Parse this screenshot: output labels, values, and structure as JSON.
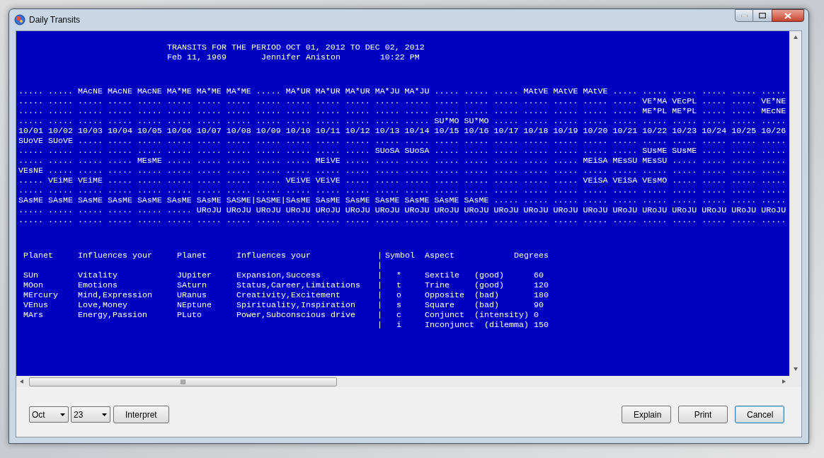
{
  "window": {
    "title": "Daily Transits"
  },
  "report": {
    "title": "TRANSITS FOR THE PERIOD OCT 01, 2012 TO DEC 02, 2012",
    "birth_date": "Feb 11, 1969",
    "name": "Jennifer Aniston",
    "birth_time": "10:22 PM",
    "grid_lines": [
      "..... ..... MAcNE MAcNE MAcNE MA*ME MA*ME MA*ME ..... MA*UR MA*UR MA*UR MA*JU MA*JU ..... ..... ..... MAtVE MAtVE MAtVE ..... ..... ..... ..... ..... .....",
      "..... ..... ..... ..... ..... ..... ..... ..... ..... ..... ..... ..... ..... ..... ..... ..... ..... ..... ..... ..... ..... VE*MA VEcPL ..... ..... VE*NE",
      "..... ..... ..... ..... ..... ..... ..... ..... ..... ..... ..... ..... ..... ..... ..... ..... ..... ..... ..... ..... ..... ME*PL ME*PL ..... ..... MEcNE",
      "..... ..... ..... ..... ..... ..... ..... ..... ..... ..... ..... ..... ..... ..... SU*MO SU*MO ..... ..... ..... ..... ..... ..... ..... ..... ..... .....",
      "10/01 10/02 10/03 10/04 10/05 10/06 10/07 10/08 10/09 10/10 10/11 10/12 10/13 10/14 10/15 10/16 10/17 10/18 10/19 10/20 10/21 10/22 10/23 10/24 10/25 10/26",
      "SUoVE SUoVE ..... ..... ..... ..... ..... ..... ..... ..... ..... ..... ..... ..... ..... ..... ..... ..... ..... ..... ..... ..... ..... ..... ..... .....",
      "..... ..... ..... ..... ..... ..... ..... ..... ..... ..... ..... ..... SUoSA SUoSA ..... ..... ..... ..... ..... ..... ..... SUsME SUsME ..... ..... .....",
      "..... ..... ..... ..... MEsME ..... ..... ..... ..... ..... MEiVE ..... ..... ..... ..... ..... ..... ..... ..... MEiSA MEsSU MEsSU ..... ..... ..... .....",
      "VEsNE ..... ..... ..... ..... ..... ..... ..... ..... ..... ..... ..... ..... ..... ..... ..... ..... ..... ..... ..... ..... ..... ..... ..... ..... .....",
      "..... VEiME VEiME ..... ..... ..... ..... ..... ..... VEiVE VEiVE ..... ..... ..... ..... ..... ..... ..... ..... VEiSA VEiSA VEsMO ..... ..... ..... .....",
      "..... ..... ..... ..... ..... ..... ..... ..... ..... ..... ..... ..... ..... ..... ..... ..... ..... ..... ..... ..... ..... ..... ..... ..... ..... .....",
      "SAsME SAsME SAsME SAsME SAsME SAsME SAsME SASME|SASME|SAsME SAsME SAsME SAsME SAsME SAsME SAsME ..... ..... ..... ..... ..... ..... ..... ..... ..... .....",
      "..... ..... ..... ..... ..... ..... URoJU URoJU URoJU URoJU URoJU URoJU URoJU URoJU URoJU URoJU URoJU URoJU URoJU URoJU URoJU URoJU URoJU URoJU URoJU URoJU",
      "..... ..... ..... ..... ..... ..... ..... ..... ..... ..... ..... ..... ..... ..... ..... ..... ..... ..... ..... ..... ..... ..... ..... ..... ..... ....."
    ]
  },
  "legend": [
    {
      "planet": "Planet",
      "influences": "Influences your",
      "planet_2": "Planet",
      "influences_2": "Influences your",
      "separator": "|",
      "symbol": "Symbol",
      "aspect": "Aspect",
      "degrees": "Degrees"
    },
    {
      "separator": "|"
    },
    {
      "planet": "SUn",
      "influences": "Vitality",
      "planet_2": "JUpiter",
      "influences_2": "Expansion,Success",
      "separator": "|",
      "symbol": "*",
      "aspect": "Sextile   (good)",
      "degrees": "60"
    },
    {
      "planet": "MOon",
      "influences": "Emotions",
      "planet_2": "SAturn",
      "influences_2": "Status,Career,Limitations",
      "separator": "|",
      "symbol": "t",
      "aspect": "Trine     (good)",
      "degrees": "120"
    },
    {
      "planet": "MErcury",
      "influences": "Mind,Expression",
      "planet_2": "URanus",
      "influences_2": "Creativity,Excitement",
      "separator": "|",
      "symbol": "o",
      "aspect": "Opposite  (bad)",
      "degrees": "180"
    },
    {
      "planet": "VEnus",
      "influences": "Love,Money",
      "planet_2": "NEptune",
      "influences_2": "Spirituality,Inspiration",
      "separator": "|",
      "symbol": "s",
      "aspect": "Square    (bad)",
      "degrees": "90"
    },
    {
      "planet": "MArs",
      "influences": "Energy,Passion",
      "planet_2": "PLuto",
      "influences_2": "Power,Subconscious drive",
      "separator": "|",
      "symbol": "c",
      "aspect": "Conjunct  (intensity)",
      "degrees": "0"
    },
    {
      "separator": "|",
      "symbol": "i",
      "aspect": "Inconjunct  (dilemma)",
      "degrees": "150"
    }
  ],
  "month": "Oct",
  "day": "23",
  "left_buttons": [
    {
      "label": "Interpret",
      "focused": false
    }
  ],
  "right_buttons": [
    {
      "label": "Explain",
      "focused": false
    },
    {
      "label": "Print",
      "focused": false
    },
    {
      "label": "Cancel",
      "focused": true
    }
  ]
}
